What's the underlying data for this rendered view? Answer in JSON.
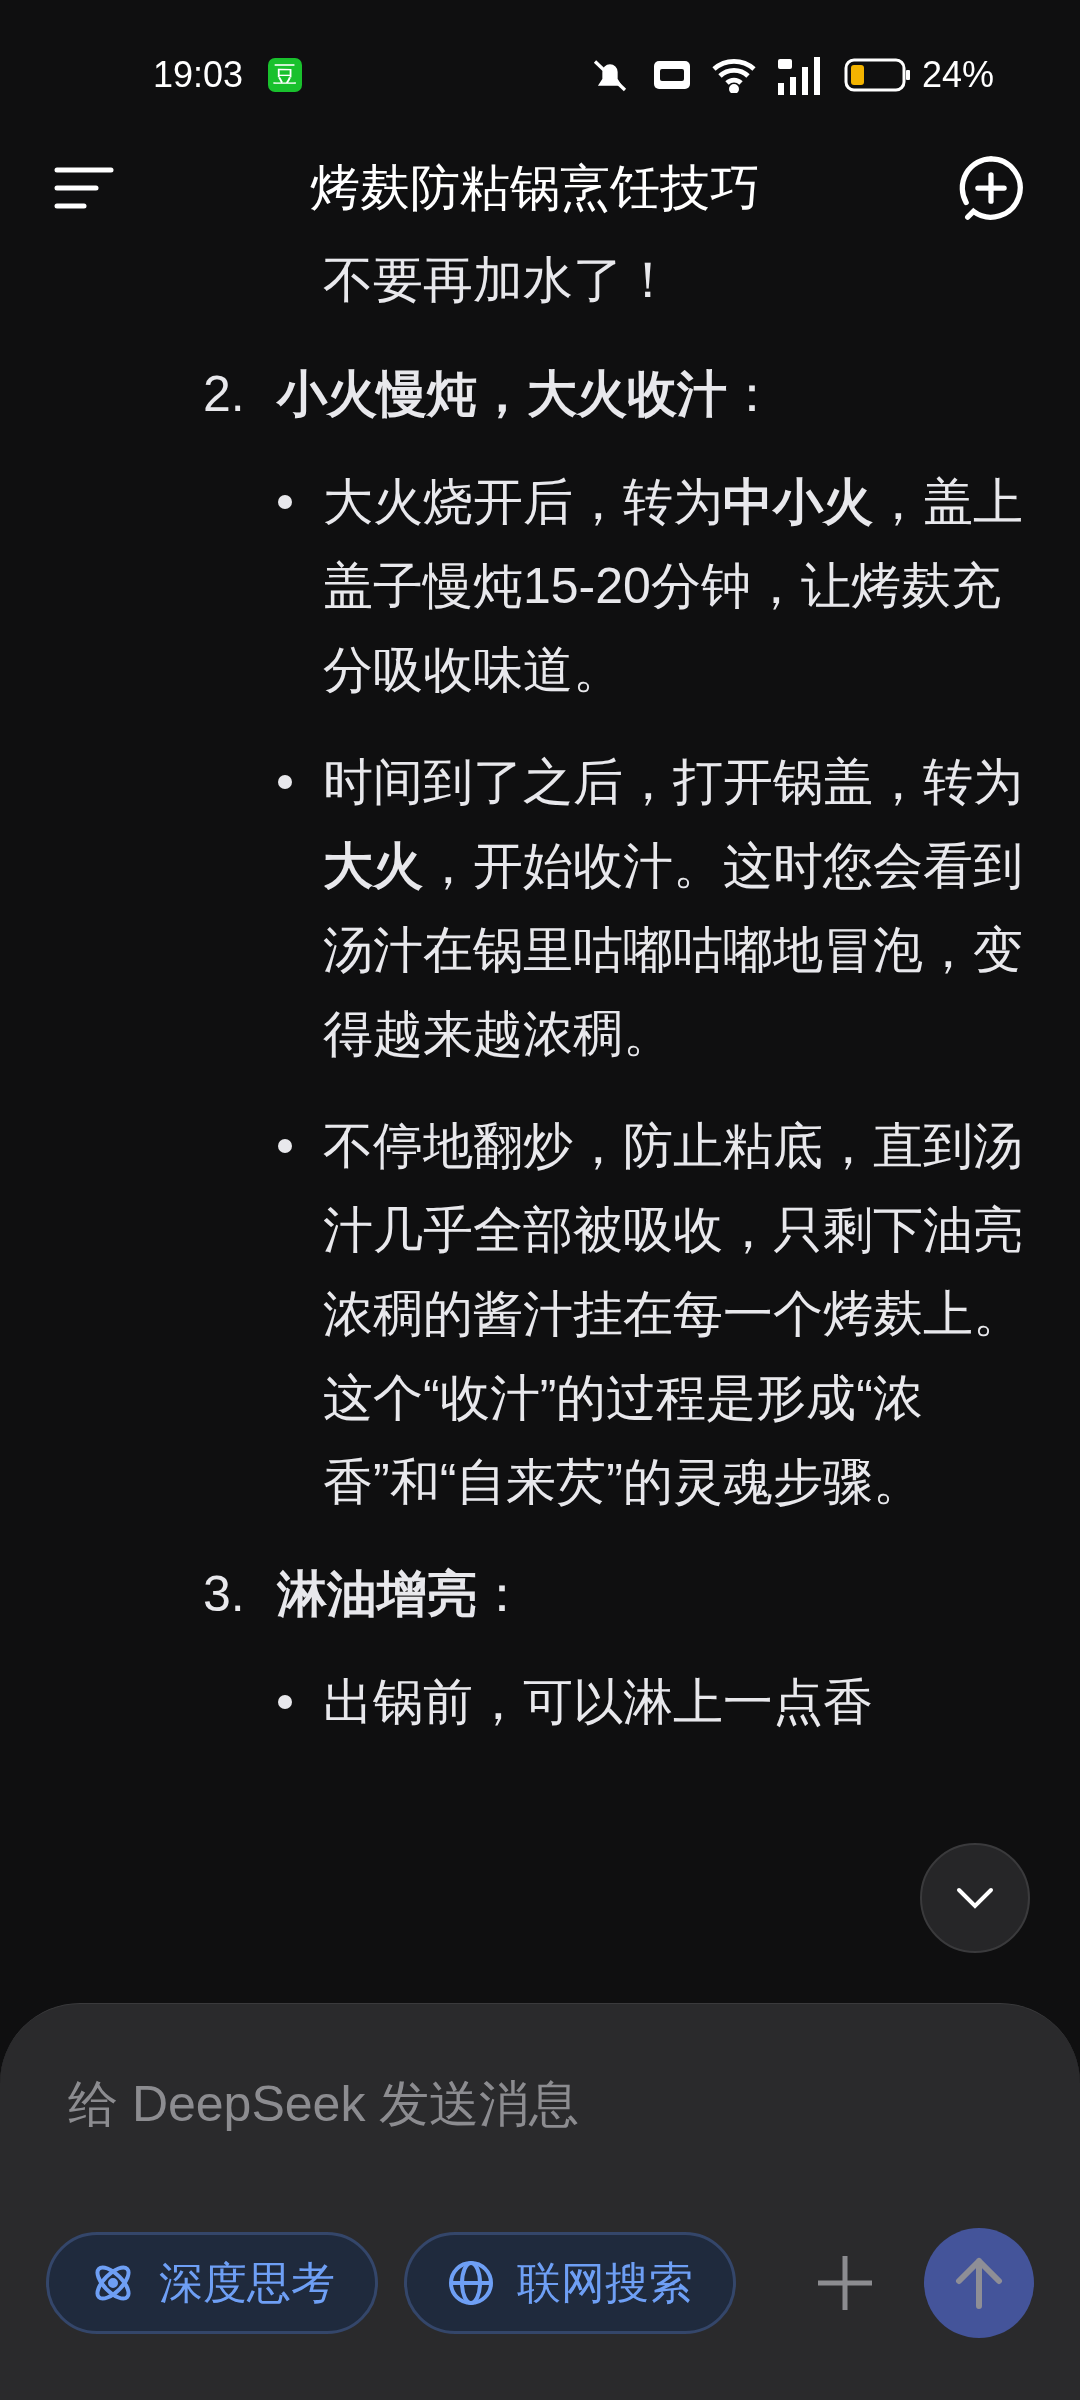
{
  "status_bar": {
    "time": "19:03",
    "app_badge": "豆",
    "battery": "24%"
  },
  "header": {
    "title": "烤麸防粘锅烹饪技巧"
  },
  "content": [
    {
      "kind": "continuation",
      "text": "不要再加水了！"
    },
    {
      "kind": "step",
      "number": "2.",
      "title": "**小火慢炖，大火收汁**：",
      "bullets": [
        "大火烧开后，转为**中小火**，盖上盖子慢炖15-20分钟，让烤麸充分吸收味道。",
        "时间到了之后，打开锅盖，转为**大火**，开始收汁。这时您会看到汤汁在锅里咕嘟咕嘟地冒泡，变得越来越浓稠。",
        "不停地翻炒，防止粘底，直到汤汁几乎全部被吸收，只剩下油亮浓稠的酱汁挂在每一个烤麸上。这个“收汁”的过程是形成“浓香”和“自来芡”的灵魂步骤。"
      ]
    },
    {
      "kind": "step",
      "number": "3.",
      "title": "**淋油增亮**：",
      "bullets": [
        "出锅前，可以淋上一点香"
      ]
    }
  ],
  "composer": {
    "placeholder": "给 DeepSeek 发送消息",
    "toggles": [
      {
        "kind": "think",
        "label": "深度思考",
        "selected": true
      },
      {
        "kind": "search",
        "label": "联网搜索",
        "selected": true
      }
    ],
    "send_disabled": true
  }
}
